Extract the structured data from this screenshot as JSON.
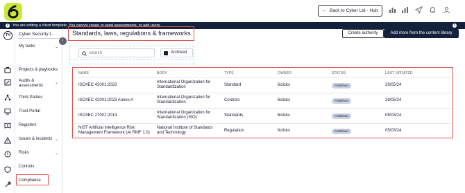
{
  "header": {
    "back_label": "Back to Cyber Ltd - Hub",
    "icons": [
      "dashboard-icon",
      "reports-icon",
      "send-icon",
      "bell-icon",
      "user-icon"
    ]
  },
  "banner": {
    "text": "You are editing a client template. You cannot create or send assessments, or add users."
  },
  "rail": {
    "avatar_initials": "TH"
  },
  "sidebar": {
    "workspace": "Cyber Security t...",
    "items": [
      {
        "label": "My tasks",
        "chevron": true
      },
      {
        "label": "Projects & playbooks",
        "chevron": false
      },
      {
        "label": "Audits &",
        "label2": "assessments",
        "chevron": true
      },
      {
        "label": "Third-Parties",
        "chevron": false
      },
      {
        "label": "Trust Portal",
        "chevron": false
      },
      {
        "label": "Registers",
        "chevron": false
      },
      {
        "label": "Issues & incidents",
        "chevron": true
      },
      {
        "label": "Risks",
        "chevron": true
      },
      {
        "label": "Controls",
        "chevron": false
      },
      {
        "label": "Compliance",
        "chevron": false
      }
    ]
  },
  "main": {
    "title": "Standards, laws, regulations & frameworks",
    "create_btn": "Create authority",
    "library_btn": "Add more from the content library",
    "search_placeholder": "Search",
    "archived_label": "Archived"
  },
  "table": {
    "columns": [
      "NAME",
      "BODY",
      "TYPE",
      "OWNER",
      "STATUS",
      "LAST UPDATED"
    ],
    "rows": [
      {
        "name": "ISO/IEC 42001:2023",
        "name2": "",
        "body": "International Organization for",
        "body2": "Standardization",
        "type": "Standard",
        "owner": "6clicks",
        "status": "Published",
        "updated": "29/05/24"
      },
      {
        "name": "ISO/IEC 42001:2023 Annex A",
        "name2": "",
        "body": "International Organization for",
        "body2": "Standardization",
        "type": "Controls",
        "owner": "6clicks",
        "status": "Published",
        "updated": "29/05/24"
      },
      {
        "name": "ISO/IEC 27001:2013",
        "name2": "",
        "body": "International Organization for",
        "body2": "Standardization (ISO)",
        "type": "Standards",
        "owner": "6clicks",
        "status": "Published",
        "updated": "05/03/24"
      },
      {
        "name": "NIST Artificial Intelligence Risk",
        "name2": "Management Framework (AI RMF 1.0)",
        "body": "National Institute of Standards",
        "body2": "and Technology",
        "type": "Regulation",
        "owner": "6clicks",
        "status": "Published",
        "updated": "05/03/24"
      }
    ]
  },
  "colors": {
    "brand_lime": "#c9e83a",
    "navy": "#14213d",
    "highlight_red": "#d9534f",
    "badge": "#c9d2e3"
  }
}
